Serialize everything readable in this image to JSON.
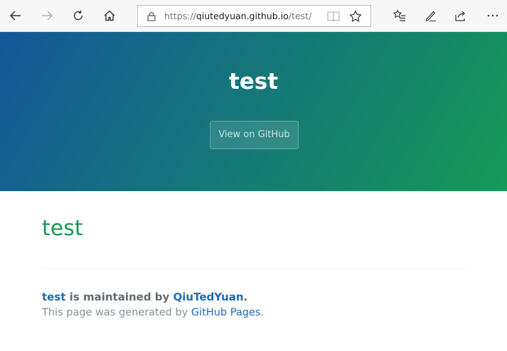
{
  "browser": {
    "url_protocol": "https://",
    "url_host": "qiutedyuan.github.io",
    "url_path": "/test/",
    "icons": [
      "back-icon",
      "forward-icon",
      "refresh-icon",
      "home-icon",
      "lock-icon",
      "reading-view-icon",
      "favorite-star-icon",
      "favorites-list-icon",
      "pen-icon",
      "share-icon",
      "more-icon"
    ]
  },
  "header": {
    "project_name": "test",
    "github_button_label": "View on GitHub",
    "gradient_from": "#155799",
    "gradient_to": "#159957"
  },
  "main": {
    "title": "test",
    "maintainer_repo": "test",
    "maintainer_middle": " is maintained by ",
    "maintainer_user": "QiuTedYuan",
    "maintainer_end": ".",
    "credits_prefix": "This page was generated by ",
    "credits_link": "GitHub Pages",
    "credits_end": "."
  },
  "colors": {
    "title_green": "#159957",
    "link_blue": "#1e6bb8"
  }
}
